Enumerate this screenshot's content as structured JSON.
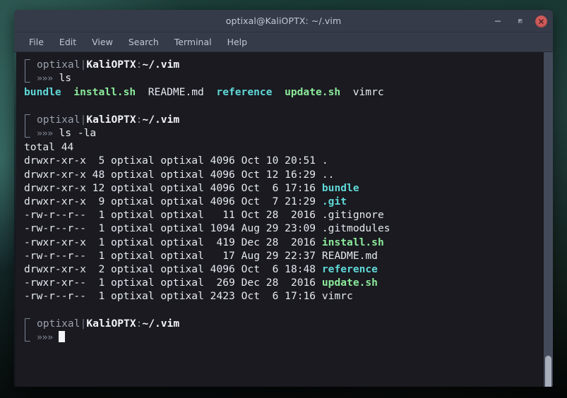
{
  "window": {
    "title": "optixal@KaliOPTX: ~/.vim",
    "buttons": {
      "minimize": "minimize-button",
      "maximize": "maximize-button",
      "close": "close-button"
    }
  },
  "menubar": {
    "items": [
      {
        "label": "File"
      },
      {
        "label": "Edit"
      },
      {
        "label": "View"
      },
      {
        "label": "Search"
      },
      {
        "label": "Terminal"
      },
      {
        "label": "Help"
      }
    ]
  },
  "terminal": {
    "prompt": {
      "user": "optixal",
      "separator": "|",
      "host": "KaliOPTX",
      "colon": ":",
      "path": "~/.vim",
      "chevrons": "»»»"
    },
    "commands": {
      "first": "ls",
      "second": "ls -la"
    },
    "ls_output": {
      "entries": [
        {
          "name": "bundle",
          "type": "dir"
        },
        {
          "name": "install.sh",
          "type": "exe"
        },
        {
          "name": "README.md",
          "type": "plain"
        },
        {
          "name": "reference",
          "type": "dir"
        },
        {
          "name": "update.sh",
          "type": "exe"
        },
        {
          "name": "vimrc",
          "type": "plain"
        }
      ]
    },
    "ls_la_output": {
      "total": "total 44",
      "rows": [
        {
          "perms": "drwxr-xr-x",
          "links": " 5",
          "owner": "optixal",
          "group": "optixal",
          "size": "4096",
          "month": "Oct",
          "day": "10",
          "time": "20:51",
          "name": ".",
          "type": "plain"
        },
        {
          "perms": "drwxr-xr-x",
          "links": "48",
          "owner": "optixal",
          "group": "optixal",
          "size": "4096",
          "month": "Oct",
          "day": "12",
          "time": "16:29",
          "name": "..",
          "type": "plain"
        },
        {
          "perms": "drwxr-xr-x",
          "links": "12",
          "owner": "optixal",
          "group": "optixal",
          "size": "4096",
          "month": "Oct",
          "day": " 6",
          "time": "17:16",
          "name": "bundle",
          "type": "dir"
        },
        {
          "perms": "drwxr-xr-x",
          "links": " 9",
          "owner": "optixal",
          "group": "optixal",
          "size": "4096",
          "month": "Oct",
          "day": " 7",
          "time": "21:29",
          "name": ".git",
          "type": "dir"
        },
        {
          "perms": "-rw-r--r--",
          "links": " 1",
          "owner": "optixal",
          "group": "optixal",
          "size": "  11",
          "month": "Oct",
          "day": "28",
          "time": " 2016",
          "name": ".gitignore",
          "type": "plain"
        },
        {
          "perms": "-rw-r--r--",
          "links": " 1",
          "owner": "optixal",
          "group": "optixal",
          "size": "1094",
          "month": "Aug",
          "day": "29",
          "time": "23:09",
          "name": ".gitmodules",
          "type": "plain"
        },
        {
          "perms": "-rwxr-xr-x",
          "links": " 1",
          "owner": "optixal",
          "group": "optixal",
          "size": " 419",
          "month": "Dec",
          "day": "28",
          "time": " 2016",
          "name": "install.sh",
          "type": "exe"
        },
        {
          "perms": "-rw-r--r--",
          "links": " 1",
          "owner": "optixal",
          "group": "optixal",
          "size": "  17",
          "month": "Aug",
          "day": "29",
          "time": "22:37",
          "name": "README.md",
          "type": "plain"
        },
        {
          "perms": "drwxr-xr-x",
          "links": " 2",
          "owner": "optixal",
          "group": "optixal",
          "size": "4096",
          "month": "Oct",
          "day": " 6",
          "time": "18:48",
          "name": "reference",
          "type": "dir"
        },
        {
          "perms": "-rwxr-xr--",
          "links": " 1",
          "owner": "optixal",
          "group": "optixal",
          "size": " 269",
          "month": "Dec",
          "day": "28",
          "time": " 2016",
          "name": "update.sh",
          "type": "exe"
        },
        {
          "perms": "-rw-r--r--",
          "links": " 1",
          "owner": "optixal",
          "group": "optixal",
          "size": "2423",
          "month": "Oct",
          "day": " 6",
          "time": "17:16",
          "name": "vimrc",
          "type": "plain"
        }
      ]
    }
  },
  "colors": {
    "directory": "#5fd7d7",
    "executable": "#8ce99a",
    "plain_file": "#e5e9f0",
    "titlebar": "#353b48",
    "terminal_bg": "#1a1a20",
    "close_button": "#d05a5a"
  }
}
